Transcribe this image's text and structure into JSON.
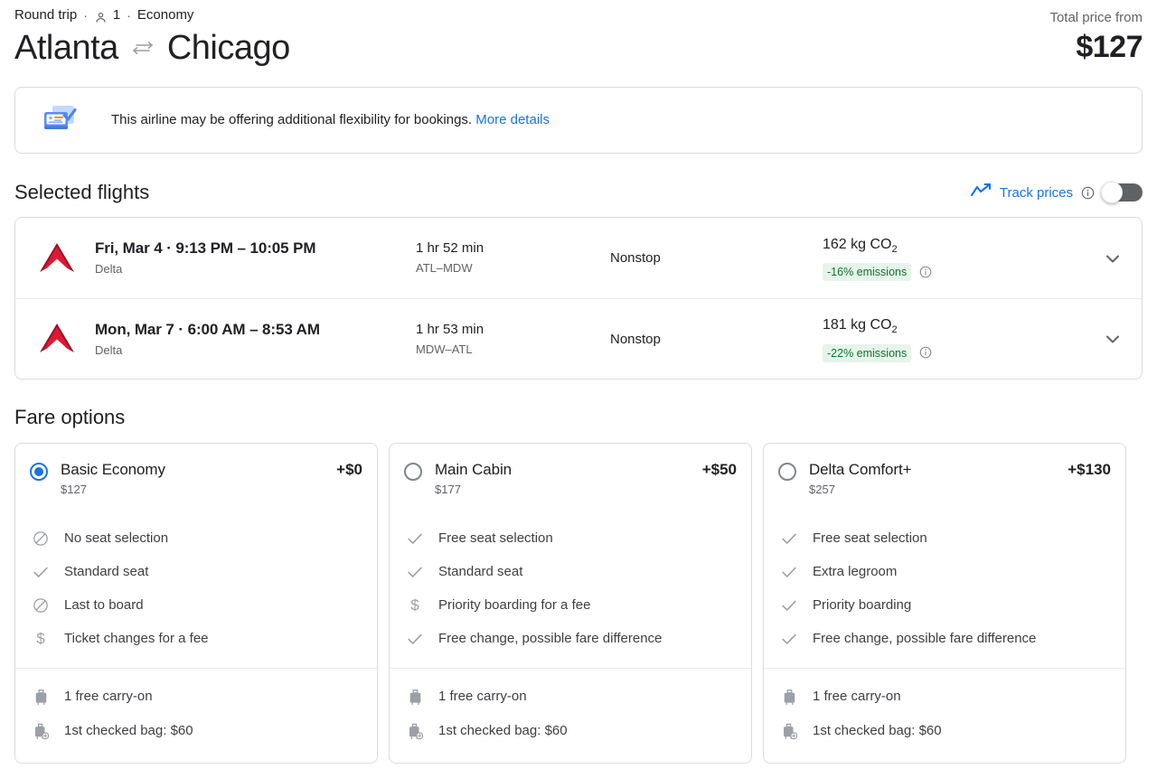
{
  "header": {
    "trip_type": "Round trip",
    "separator": "·",
    "passenger_icon": "person-icon",
    "passengers": "1",
    "cabin_class": "Economy",
    "origin": "Atlanta",
    "swap_icon": "swap-arrows-icon",
    "destination": "Chicago",
    "total_price_label": "Total price from",
    "total_price": "$127"
  },
  "flex_banner": {
    "icon": "flexible-booking-icon",
    "text": "This airline may be offering additional flexibility for bookings.",
    "link_label": "More details"
  },
  "selected_flights": {
    "title": "Selected flights",
    "track_prices": {
      "chart_icon": "trending-up-icon",
      "label": "Track prices",
      "info_icon": "info-icon",
      "toggle_state": "off"
    },
    "flights": [
      {
        "airline_logo": "delta-logo-icon",
        "datetime": "Fri, Mar 4  ·  9:13 PM – 10:05 PM",
        "airline": "Delta",
        "duration": "1 hr 52 min",
        "route": "ATL–MDW",
        "stops": "Nonstop",
        "emissions": "162 kg CO",
        "emissions_sub": "2",
        "emissions_badge": "-16% emissions",
        "emissions_info_icon": "info-icon",
        "expand_icon": "chevron-down-icon"
      },
      {
        "airline_logo": "delta-logo-icon",
        "datetime": "Mon, Mar 7  ·  6:00 AM – 8:53 AM",
        "airline": "Delta",
        "duration": "1 hr 53 min",
        "route": "MDW–ATL",
        "stops": "Nonstop",
        "emissions": "181 kg CO",
        "emissions_sub": "2",
        "emissions_badge": "-22% emissions",
        "emissions_info_icon": "info-icon",
        "expand_icon": "chevron-down-icon"
      }
    ]
  },
  "fare_options": {
    "title": "Fare options",
    "cards": [
      {
        "selected": true,
        "name": "Basic Economy",
        "base_price": "$127",
        "price_delta": "+$0",
        "features": [
          {
            "icon": "block-icon",
            "label": "No seat selection"
          },
          {
            "icon": "check-icon",
            "label": "Standard seat"
          },
          {
            "icon": "block-icon",
            "label": "Last to board"
          },
          {
            "icon": "dollar-icon",
            "label": "Ticket changes for a fee"
          }
        ],
        "baggage": [
          {
            "icon": "carry-on-bag-icon",
            "label": "1 free carry-on"
          },
          {
            "icon": "checked-bag-icon",
            "label": "1st checked bag: $60"
          }
        ]
      },
      {
        "selected": false,
        "name": "Main Cabin",
        "base_price": "$177",
        "price_delta": "+$50",
        "features": [
          {
            "icon": "check-icon",
            "label": "Free seat selection"
          },
          {
            "icon": "check-icon",
            "label": "Standard seat"
          },
          {
            "icon": "dollar-icon",
            "label": "Priority boarding for a fee"
          },
          {
            "icon": "check-icon",
            "label": "Free change, possible fare difference"
          }
        ],
        "baggage": [
          {
            "icon": "carry-on-bag-icon",
            "label": "1 free carry-on"
          },
          {
            "icon": "checked-bag-icon",
            "label": "1st checked bag: $60"
          }
        ]
      },
      {
        "selected": false,
        "name": "Delta Comfort+",
        "base_price": "$257",
        "price_delta": "+$130",
        "features": [
          {
            "icon": "check-icon",
            "label": "Free seat selection"
          },
          {
            "icon": "check-icon",
            "label": "Extra legroom"
          },
          {
            "icon": "check-icon",
            "label": "Priority boarding"
          },
          {
            "icon": "check-icon",
            "label": "Free change, possible fare difference"
          }
        ],
        "baggage": [
          {
            "icon": "carry-on-bag-icon",
            "label": "1 free carry-on"
          },
          {
            "icon": "checked-bag-icon",
            "label": "1st checked bag: $60"
          }
        ]
      }
    ]
  },
  "colors": {
    "accent_blue": "#1a73e8",
    "emissions_green_text": "#137333",
    "emissions_green_bg": "#e6f4ea",
    "delta_red": "#c8102e",
    "border": "#dadce0",
    "muted_text": "#5f6368"
  }
}
